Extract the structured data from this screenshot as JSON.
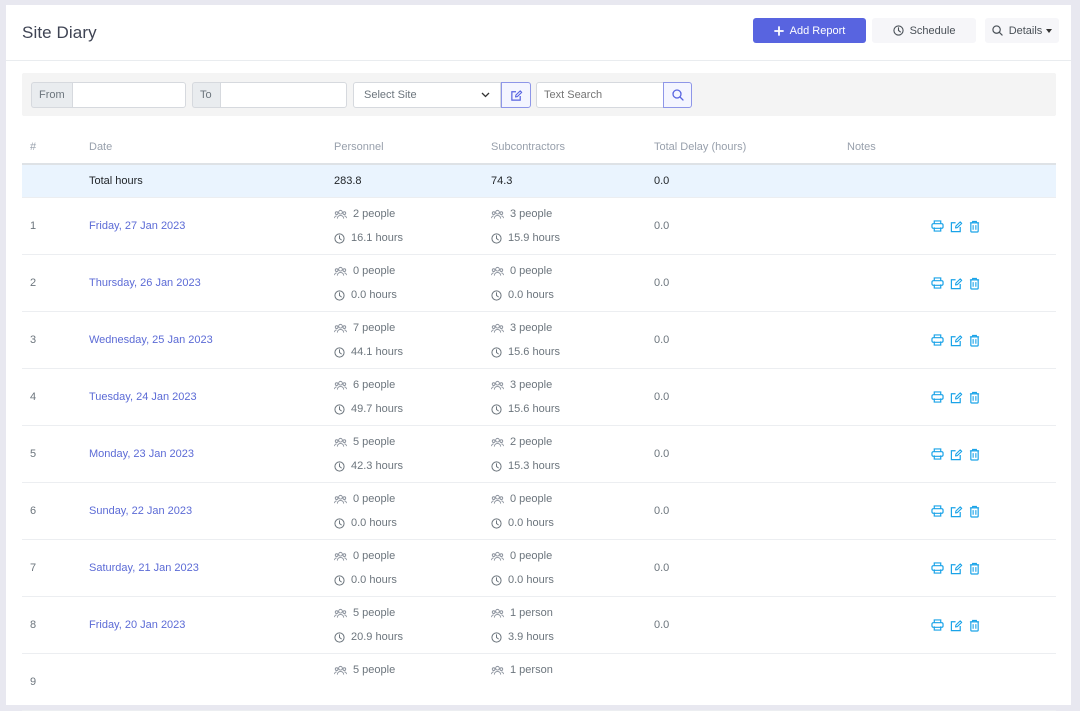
{
  "header": {
    "title": "Site Diary",
    "add_report_label": "Add Report",
    "schedule_label": "Schedule",
    "details_label": "Details"
  },
  "filters": {
    "from_label": "From",
    "from_value": "",
    "to_label": "To",
    "to_value": "",
    "site_select_value": "Select Site",
    "text_search_placeholder": "Text Search",
    "text_search_value": ""
  },
  "colors": {
    "primary": "#5864e0",
    "link": "#5c6bd6",
    "action_icon": "#1aa3e8",
    "total_row_bg": "#eaf4fe"
  },
  "table": {
    "columns": [
      "#",
      "Date",
      "Personnel",
      "Subcontractors",
      "Total Delay (hours)",
      "Notes"
    ],
    "total": {
      "label": "Total hours",
      "personnel": "283.8",
      "subcontractors": "74.3",
      "delay": "0.0"
    },
    "rows": [
      {
        "num": "1",
        "date": "Friday, 27 Jan 2023",
        "pers_people": "2 people",
        "pers_hours": "16.1 hours",
        "sub_people": "3 people",
        "sub_hours": "15.9 hours",
        "delay": "0.0",
        "notes": ""
      },
      {
        "num": "2",
        "date": "Thursday, 26 Jan 2023",
        "pers_people": "0 people",
        "pers_hours": "0.0 hours",
        "sub_people": "0 people",
        "sub_hours": "0.0 hours",
        "delay": "0.0",
        "notes": ""
      },
      {
        "num": "3",
        "date": "Wednesday, 25 Jan 2023",
        "pers_people": "7 people",
        "pers_hours": "44.1 hours",
        "sub_people": "3 people",
        "sub_hours": "15.6 hours",
        "delay": "0.0",
        "notes": ""
      },
      {
        "num": "4",
        "date": "Tuesday, 24 Jan 2023",
        "pers_people": "6 people",
        "pers_hours": "49.7 hours",
        "sub_people": "3 people",
        "sub_hours": "15.6 hours",
        "delay": "0.0",
        "notes": ""
      },
      {
        "num": "5",
        "date": "Monday, 23 Jan 2023",
        "pers_people": "5 people",
        "pers_hours": "42.3 hours",
        "sub_people": "2 people",
        "sub_hours": "15.3 hours",
        "delay": "0.0",
        "notes": ""
      },
      {
        "num": "6",
        "date": "Sunday, 22 Jan 2023",
        "pers_people": "0 people",
        "pers_hours": "0.0 hours",
        "sub_people": "0 people",
        "sub_hours": "0.0 hours",
        "delay": "0.0",
        "notes": ""
      },
      {
        "num": "7",
        "date": "Saturday, 21 Jan 2023",
        "pers_people": "0 people",
        "pers_hours": "0.0 hours",
        "sub_people": "0 people",
        "sub_hours": "0.0 hours",
        "delay": "0.0",
        "notes": ""
      },
      {
        "num": "8",
        "date": "Friday, 20 Jan 2023",
        "pers_people": "5 people",
        "pers_hours": "20.9 hours",
        "sub_people": "1 person",
        "sub_hours": "3.9 hours",
        "delay": "0.0",
        "notes": ""
      },
      {
        "num": "9",
        "date": "",
        "pers_people": "5 people",
        "pers_hours": "",
        "sub_people": "1 person",
        "sub_hours": "",
        "delay": "",
        "notes": ""
      }
    ]
  }
}
